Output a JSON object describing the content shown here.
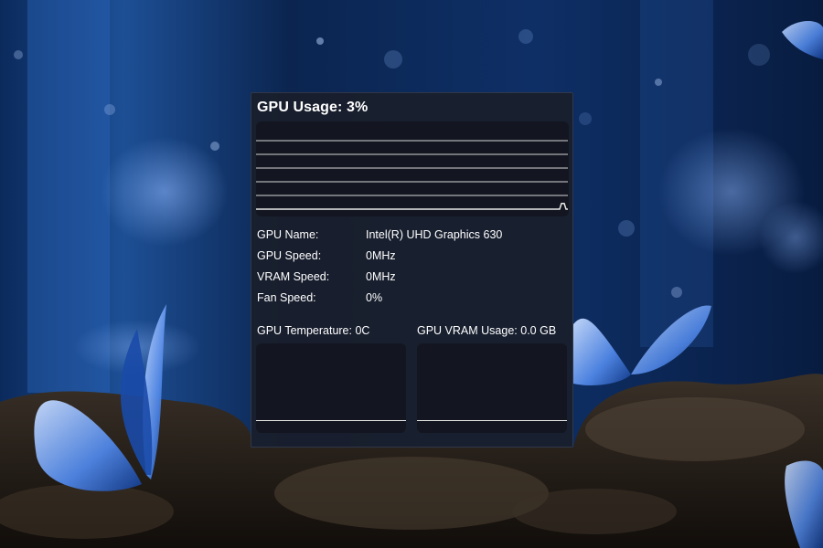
{
  "widget": {
    "title_prefix": "GPU Usage:",
    "usage": "3%",
    "usage_fraction": 0.03,
    "info": [
      {
        "label": "GPU Name:",
        "value": "Intel(R) UHD Graphics 630"
      },
      {
        "label": "GPU Speed:",
        "value": "0MHz"
      },
      {
        "label": "VRAM Speed:",
        "value": "0MHz"
      },
      {
        "label": "Fan Speed:",
        "value": "0%"
      }
    ],
    "temperature": {
      "label": "GPU Temperature:",
      "value": "0C"
    },
    "vram_usage": {
      "label": "GPU VRAM Usage:",
      "value": "0.0 GB"
    }
  },
  "colors": {
    "widget_bg": "#1a1e28",
    "text": "#ffffff",
    "graph_line": "#e8e8e8"
  }
}
